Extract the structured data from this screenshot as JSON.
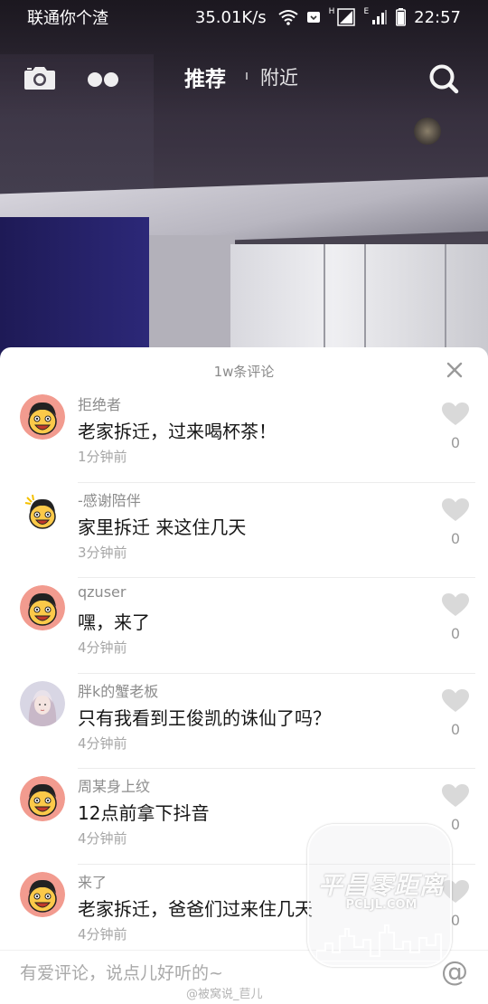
{
  "status_bar": {
    "carrier": "联通你个渣",
    "net_speed": "35.01K/s",
    "network_h": "H",
    "network_e": "E",
    "time": "22:57"
  },
  "top_nav": {
    "tab_recommend": "推荐",
    "tab_nearby": "附近",
    "active_tab": "推荐"
  },
  "comments_sheet": {
    "title": "1w条评论",
    "comments": [
      {
        "user": "拒绝者",
        "text": "老家拆迁，过来喝杯茶！",
        "time": "1分钟前",
        "likes": "0"
      },
      {
        "user": "-感谢陪伴",
        "text": "家里拆迁 来这住几天",
        "time": "3分钟前",
        "likes": "0"
      },
      {
        "user": "qzuser",
        "text": "嘿，来了",
        "time": "4分钟前",
        "likes": "0"
      },
      {
        "user": "胖k的蟹老板",
        "text": "只有我看到王俊凯的诛仙了吗？",
        "time": "4分钟前",
        "likes": "0"
      },
      {
        "user": "周某身上纹",
        "text": "12点前拿下抖音",
        "time": "4分钟前",
        "likes": "0"
      },
      {
        "user": "来了",
        "text": "老家拆迁，爸爸们过来住几天",
        "time": "4分钟前",
        "likes": "0"
      }
    ]
  },
  "input_bar": {
    "placeholder": "有爱评论，说点儿好听的~",
    "at_symbol": "@"
  },
  "watermark": {
    "logo_text": "平昌零距离",
    "logo_domain": "PCLJL.COM",
    "credit": "@被窝说_苣儿"
  },
  "colors": {
    "comment_text": "#161616",
    "username": "#8c8c8c",
    "timestamp": "#a6a6a6",
    "like_heart": "#d9d9d9"
  }
}
